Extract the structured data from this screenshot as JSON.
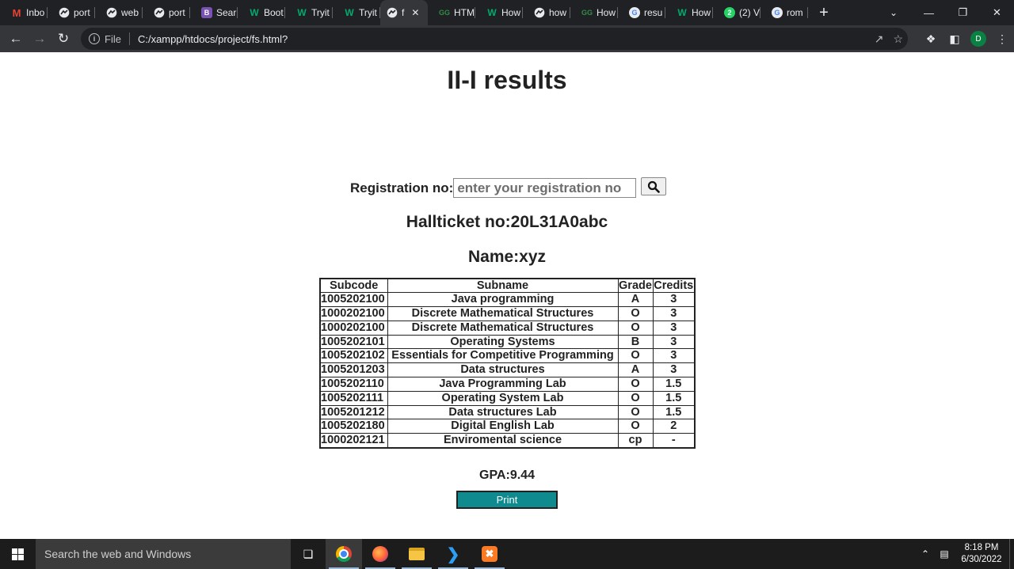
{
  "browser": {
    "tabs": [
      {
        "title": "Inbo",
        "icon": "gmail-icon",
        "glyph": "M",
        "fav": "gmail"
      },
      {
        "title": "port",
        "icon": "globe-icon",
        "glyph": "",
        "fav": ""
      },
      {
        "title": "web",
        "icon": "globe-icon",
        "glyph": "",
        "fav": ""
      },
      {
        "title": "port",
        "icon": "globe-icon",
        "glyph": "",
        "fav": ""
      },
      {
        "title": "Sear",
        "icon": "bootstrap-icon",
        "glyph": "B",
        "fav": "boot"
      },
      {
        "title": "Boot",
        "icon": "w3schools-icon",
        "glyph": "W",
        "fav": "w3"
      },
      {
        "title": "Tryit",
        "icon": "w3schools-icon",
        "glyph": "W",
        "fav": "w3"
      },
      {
        "title": "Tryit",
        "icon": "w3schools-icon",
        "glyph": "W",
        "fav": "w3"
      },
      {
        "title": "f",
        "icon": "globe-icon",
        "glyph": "",
        "fav": "",
        "active": true
      },
      {
        "title": "HTM",
        "icon": "gfg-icon",
        "glyph": "GG",
        "fav": "gfg"
      },
      {
        "title": "How",
        "icon": "w3schools-icon",
        "glyph": "W",
        "fav": "w3"
      },
      {
        "title": "how",
        "icon": "globe-icon",
        "glyph": "",
        "fav": ""
      },
      {
        "title": "How",
        "icon": "gfg-icon",
        "glyph": "GG",
        "fav": "gfg"
      },
      {
        "title": "resu",
        "icon": "google-icon",
        "glyph": "G",
        "fav": "goog"
      },
      {
        "title": "How",
        "icon": "w3schools-icon",
        "glyph": "W",
        "fav": "w3"
      },
      {
        "title": "(2) V",
        "icon": "whatsapp-icon",
        "glyph": "2",
        "fav": "wa"
      },
      {
        "title": "rom",
        "icon": "google-icon",
        "glyph": "G",
        "fav": "goog"
      }
    ],
    "address": {
      "scheme_label": "File",
      "url": "C:/xampp/htdocs/project/fs.html?"
    },
    "profile_initial": "D"
  },
  "page": {
    "title": "II-I results",
    "registration_label": "Registration no:",
    "registration_placeholder": "enter your registration no",
    "hallticket_label": "Hallticket no:",
    "hallticket_value": "20L31A0abc",
    "name_label": "Name:",
    "name_value": "xyz",
    "table": {
      "headers": [
        "Subcode",
        "Subname",
        "Grade",
        "Credits"
      ],
      "rows": [
        [
          "1005202100",
          "Java programming",
          "A",
          "3"
        ],
        [
          "1000202100",
          "Discrete Mathematical Structures",
          "O",
          "3"
        ],
        [
          "1000202100",
          "Discrete Mathematical Structures",
          "O",
          "3"
        ],
        [
          "1005202101",
          "Operating Systems",
          "B",
          "3"
        ],
        [
          "1005202102",
          "Essentials for Competitive Programming",
          "O",
          "3"
        ],
        [
          "1005201203",
          "Data structures",
          "A",
          "3"
        ],
        [
          "1005202110",
          "Java Programming Lab",
          "O",
          "1.5"
        ],
        [
          "1005202111",
          "Operating System Lab",
          "O",
          "1.5"
        ],
        [
          "1005201212",
          "Data structures Lab",
          "O",
          "1.5"
        ],
        [
          "1005202180",
          "Digital English Lab",
          "O",
          "2"
        ],
        [
          "1000202121",
          "Enviromental science",
          "cp",
          "-"
        ]
      ]
    },
    "gpa_label": "GPA:",
    "gpa_value": "9.44",
    "print_label": "Print"
  },
  "taskbar": {
    "search_placeholder": "Search the web and Windows",
    "time": "8:18 PM",
    "date": "6/30/2022"
  },
  "colors": {
    "print_button": "#0f8a8e",
    "tab_strip": "#202124",
    "toolbar": "#35363a"
  }
}
